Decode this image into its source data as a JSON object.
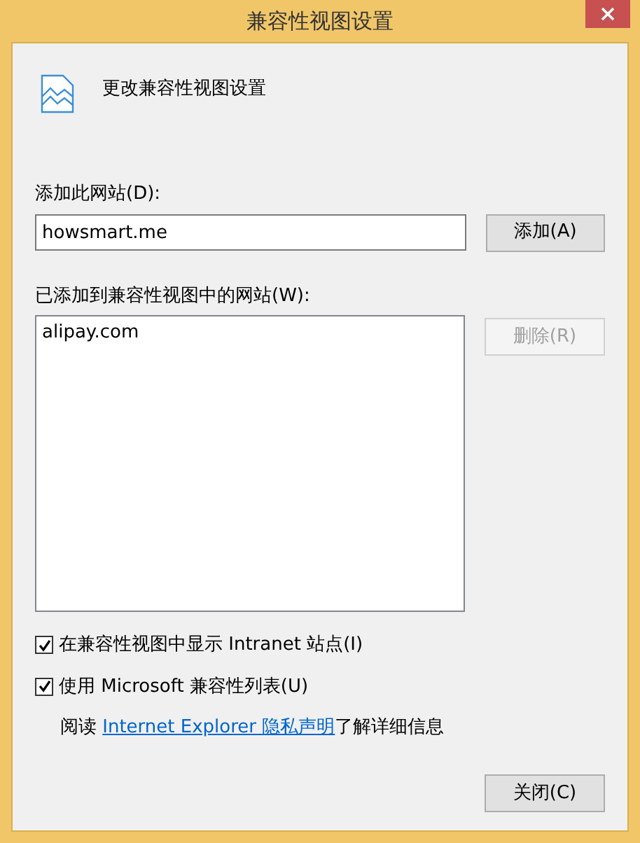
{
  "window": {
    "title": "兼容性视图设置"
  },
  "heading": "更改兼容性视图设置",
  "add_site": {
    "label": "添加此网站(D):",
    "value": "howsmart.me",
    "button": {
      "label": "添加(A)",
      "disabled": false
    }
  },
  "sites": {
    "label": "已添加到兼容性视图中的网站(W):",
    "items": [
      {
        "label": "alipay.com",
        "selected": false
      }
    ],
    "remove_button": {
      "label": "删除(R)",
      "disabled": true
    }
  },
  "options": [
    {
      "label": "在兼容性视图中显示 Intranet 站点(I)",
      "checked": true
    },
    {
      "label": "使用 Microsoft 兼容性列表(U)",
      "checked": true
    }
  ],
  "info": {
    "before": "阅读 ",
    "link": "Internet Explorer 隐私声明",
    "after": "了解详细信息"
  },
  "close_button": {
    "label": "关闭(C)",
    "disabled": false
  }
}
